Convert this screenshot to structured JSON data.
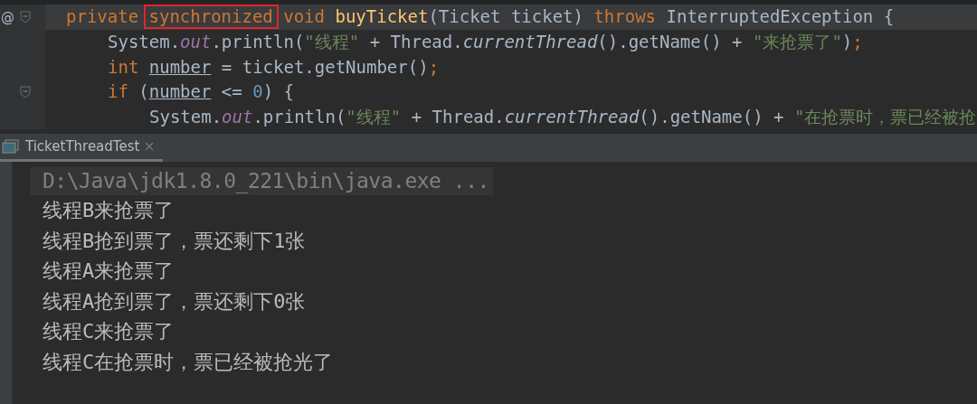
{
  "editor": {
    "lines": [
      {
        "marker": "@",
        "fold": true,
        "current": true,
        "tokens": [
          {
            "kind": "keyword",
            "text": "private "
          },
          {
            "kind": "keyword",
            "text": "synchronized",
            "highlighted": true
          },
          {
            "kind": "keyword",
            "text": " void "
          },
          {
            "kind": "method",
            "text": "buyTicket"
          },
          {
            "kind": "plain",
            "text": "(Ticket ticket) "
          },
          {
            "kind": "keyword",
            "text": "throws "
          },
          {
            "kind": "plain",
            "text": "InterruptedException {"
          }
        ],
        "children": [
          {
            "fold": false,
            "current": false,
            "tokens": [
              {
                "kind": "plain",
                "text": "System."
              },
              {
                "kind": "static",
                "text": "out"
              },
              {
                "kind": "plain",
                "text": ".println("
              },
              {
                "kind": "string",
                "text": "\"线程\""
              },
              {
                "kind": "plain",
                "text": " + Thread."
              },
              {
                "kind": "italic",
                "text": "currentThread"
              },
              {
                "kind": "plain",
                "text": "().getName() + "
              },
              {
                "kind": "string",
                "text": "\"来抢票了\""
              },
              {
                "kind": "plain",
                "text": ")"
              },
              {
                "kind": "keyword",
                "text": ";"
              }
            ]
          },
          {
            "fold": false,
            "current": false,
            "tokens": [
              {
                "kind": "keyword",
                "text": "int "
              },
              {
                "kind": "local",
                "text": "number"
              },
              {
                "kind": "plain",
                "text": " = ticket.getNumber()"
              },
              {
                "kind": "keyword",
                "text": ";"
              }
            ]
          },
          {
            "fold": true,
            "current": false,
            "tokens": [
              {
                "kind": "keyword",
                "text": "if "
              },
              {
                "kind": "plain",
                "text": "("
              },
              {
                "kind": "local",
                "text": "number"
              },
              {
                "kind": "plain",
                "text": " <= "
              },
              {
                "kind": "number",
                "text": "0"
              },
              {
                "kind": "plain",
                "text": ") {"
              }
            ],
            "children": [
              {
                "fold": false,
                "current": false,
                "tokens": [
                  {
                    "kind": "plain",
                    "text": "System."
                  },
                  {
                    "kind": "static",
                    "text": "out"
                  },
                  {
                    "kind": "plain",
                    "text": ".println("
                  },
                  {
                    "kind": "string",
                    "text": "\"线程\""
                  },
                  {
                    "kind": "plain",
                    "text": " + Thread."
                  },
                  {
                    "kind": "italic",
                    "text": "currentThread"
                  },
                  {
                    "kind": "plain",
                    "text": "().getName() + "
                  },
                  {
                    "kind": "string",
                    "text": "\"在抢票时，票已经被抢"
                  }
                ]
              }
            ]
          }
        ]
      }
    ]
  },
  "run_tabs": [
    {
      "label": "TicketThreadTest",
      "selected": true
    }
  ],
  "console": {
    "command": "D:\\Java\\jdk1.8.0_221\\bin\\java.exe ...",
    "output": [
      "线程B来抢票了",
      "线程B抢到票了，票还剩下1张",
      "线程A来抢票了",
      "线程A抢到票了，票还剩下0张",
      "线程C来抢票了",
      "线程C在抢票时，票已经被抢光了"
    ]
  }
}
